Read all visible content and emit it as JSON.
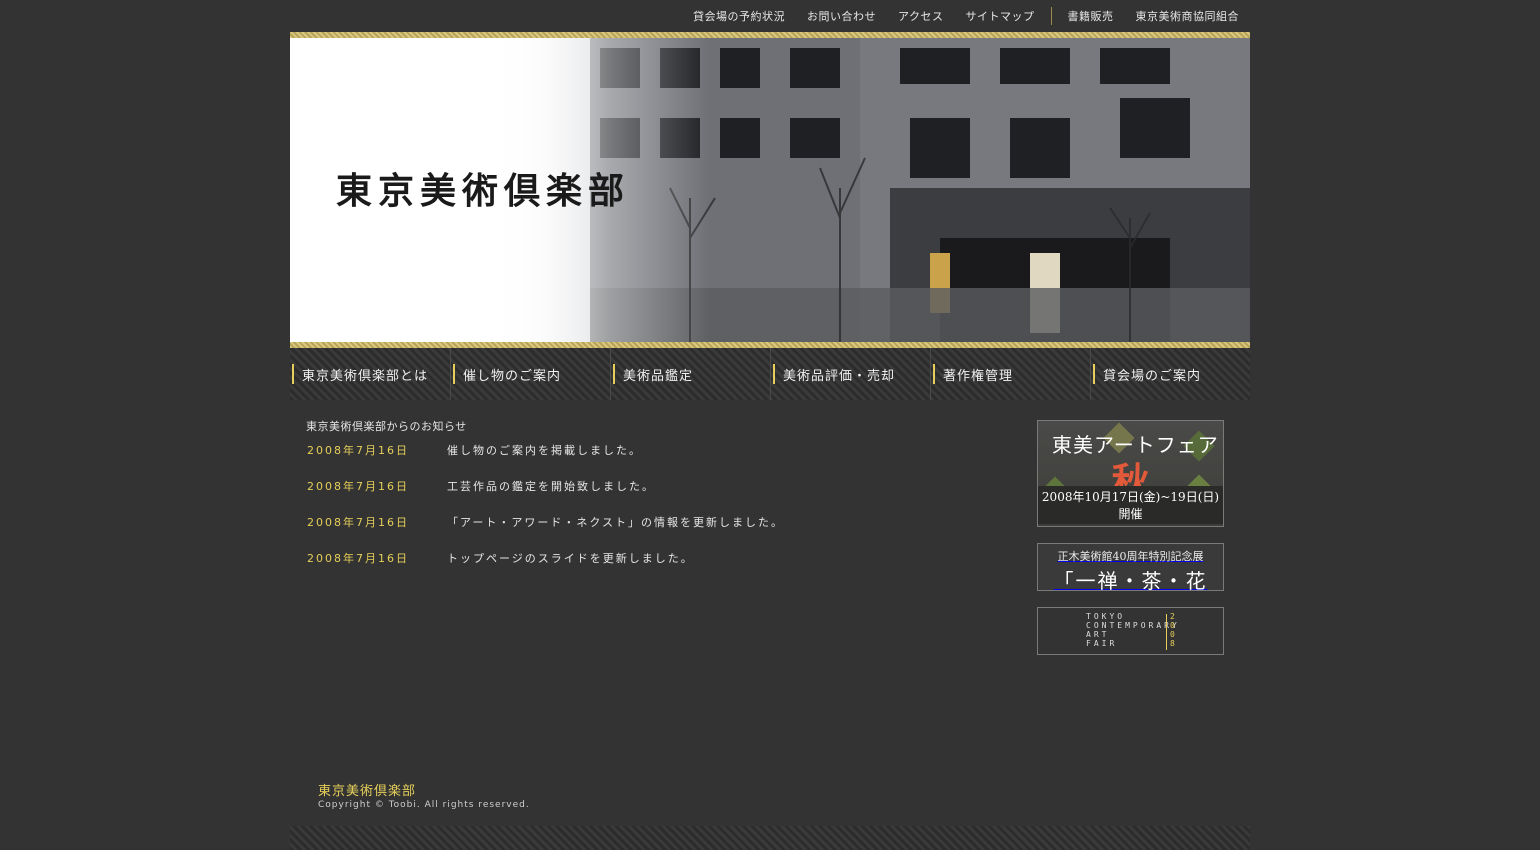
{
  "top_nav": {
    "items": [
      "貸会場の予約状況",
      "お問い合わせ",
      "アクセス",
      "サイトマップ"
    ],
    "items_right": [
      "書籍販売",
      "東京美術商協同組合"
    ]
  },
  "header": {
    "title": "東京美術倶楽部"
  },
  "main_nav": [
    "東京美術倶楽部とは",
    "催し物のご案内",
    "美術品鑑定",
    "美術品評価・売却",
    "著作権管理",
    "貸会場のご案内"
  ],
  "news": {
    "heading": "東京美術倶楽部からのお知らせ",
    "items": [
      {
        "date": "2008年7月16日",
        "text": "催し物のご案内を掲載しました。"
      },
      {
        "date": "2008年7月16日",
        "text": "工芸作品の鑑定を開始致しました。"
      },
      {
        "date": "2008年7月16日",
        "text": "「アート・アワード・ネクスト」の情報を更新しました。"
      },
      {
        "date": "2008年7月16日",
        "text": "トップページのスライドを更新しました。"
      }
    ]
  },
  "banners": {
    "art_fair": {
      "title": "東美アートフェア",
      "season": "秋",
      "dates": "2008年10月17日(金)~19日(日)開催"
    },
    "exhibition": {
      "line1": "正木美術館40周年特別記念展",
      "line2": "「一禅・茶・花一」"
    },
    "tcaf": {
      "line1": "TOKYO",
      "line2": "CONTEMPORARY",
      "line3": "ART",
      "line4": "FAIR",
      "year": "2008"
    }
  },
  "footer": {
    "logo": "東京美術倶楽部",
    "copyright": "Copyright © Toobi. All rights reserved."
  },
  "colors": {
    "background": "#333333",
    "accent": "#e6cf5a"
  }
}
